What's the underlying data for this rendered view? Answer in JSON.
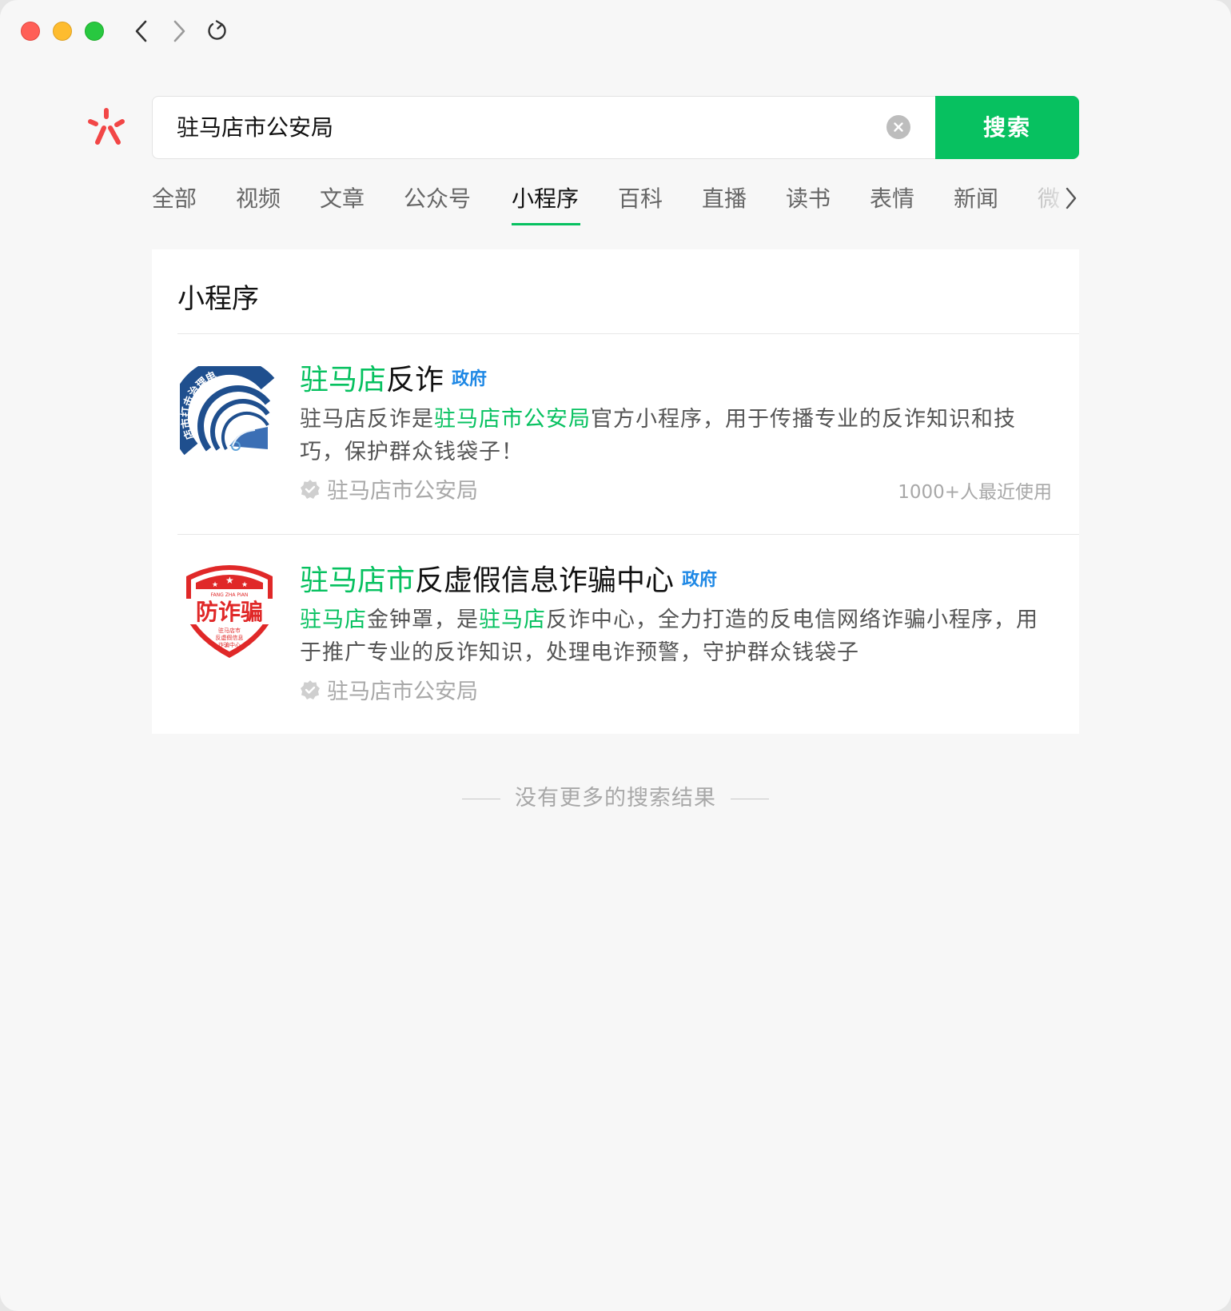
{
  "search": {
    "query": "驻马店市公安局",
    "button_label": "搜索"
  },
  "tabs": [
    {
      "label": "全部"
    },
    {
      "label": "视频"
    },
    {
      "label": "文章"
    },
    {
      "label": "公众号"
    },
    {
      "label": "小程序",
      "active": true
    },
    {
      "label": "百科"
    },
    {
      "label": "直播"
    },
    {
      "label": "读书"
    },
    {
      "label": "表情"
    },
    {
      "label": "新闻"
    },
    {
      "label": "微"
    }
  ],
  "section": {
    "title": "小程序"
  },
  "results": [
    {
      "title_highlight": "驻马店",
      "title_rest": "反诈",
      "tag": "政府",
      "desc_parts": [
        {
          "text": "驻马店反诈是",
          "hl": false
        },
        {
          "text": "驻马店市公安局",
          "hl": true
        },
        {
          "text": "官方小程序，用于传播专业的反诈知识和技巧，保护群众钱袋子！",
          "hl": false
        }
      ],
      "publisher": "驻马店市公安局",
      "usage": "1000+人最近使用",
      "icon_text": "店市打击治理电"
    },
    {
      "title_highlight": "驻马店市",
      "title_rest": "反虚假信息诈骗中心",
      "tag": "政府",
      "desc_parts": [
        {
          "text": "驻马店",
          "hl": true
        },
        {
          "text": "金钟罩，是",
          "hl": false
        },
        {
          "text": "驻马店",
          "hl": true
        },
        {
          "text": "反诈中心，全力打造的反电信网络诈骗小程序，用于推广专业的反诈知识，处理电诈预警，守护群众钱袋子",
          "hl": false
        }
      ],
      "publisher": "驻马店市公安局",
      "icon_text": "防诈骗",
      "icon_subtext": "FANG ZHA PIAN",
      "icon_smalltext": [
        "驻马店市",
        "反虚假信息",
        "诈骗中心"
      ]
    }
  ],
  "footer": {
    "text": "没有更多的搜索结果"
  },
  "colors": {
    "brand_green": "#07c160",
    "gov_blue": "#1e88e5",
    "logo_red": "#f24646"
  }
}
